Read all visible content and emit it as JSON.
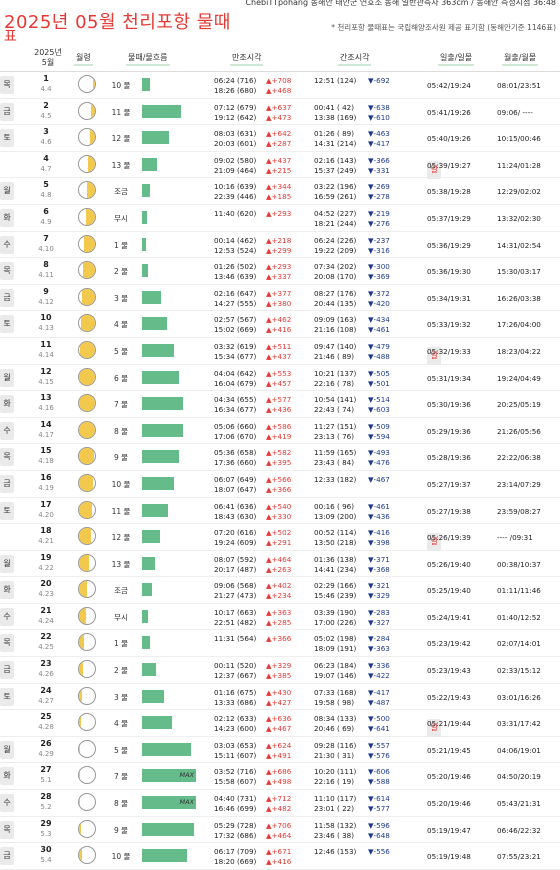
{
  "header": {
    "top_line": "ChebiTTpohang 동해안 태안군 연호소 동해 일반관측자 363cm / 동해안 측정시점 36:48",
    "title": "2025년 05월 천리포항 물때",
    "title_line2": "표",
    "note": "* 천리포항 물때표는 국립해양조사원 제공 표기함 (동해안기준 1146표)"
  },
  "columns": {
    "date_line1": "2025년",
    "date_line2": "5월",
    "moon": "월령",
    "tide": "물때/물흐름",
    "high": "만조시각",
    "low": "간조시각",
    "sun": "일출/일몰",
    "moonrs": "월출/월몰"
  },
  "rows": [
    {
      "dow": "목",
      "day": "1",
      "lunar": "4.4",
      "phase": 0.15,
      "tide": "10 물",
      "flow": 0.14,
      "max": "",
      "h1": "06:24 (716)",
      "hd1": "▲+708",
      "h2": "18:26 (680)",
      "hd2": "▲+468",
      "l1": "12:51 (124)",
      "ld1": "▼-692",
      "l2": "",
      "ld2": "",
      "sun": "05:42/19:24",
      "mrs": "08:01/23:51"
    },
    {
      "dow": "금",
      "day": "2",
      "lunar": "4.5",
      "phase": 0.25,
      "tide": "11 물",
      "flow": 0.72,
      "max": "",
      "h1": "07:12 (679)",
      "hd1": "▲+637",
      "h2": "19:12 (642)",
      "hd2": "▲+473",
      "l1": "00:41 ( 42)",
      "ld1": "▼-638",
      "l2": "13:38 (169)",
      "ld2": "▼-610",
      "sun": "05:41/19:26",
      "mrs": "09:06/ ----"
    },
    {
      "dow": "토",
      "day": "3",
      "lunar": "4.6",
      "phase": 0.33,
      "tide": "12 물",
      "flow": 0.5,
      "max": "",
      "h1": "08:03 (631)",
      "hd1": "▲+642",
      "h2": "20:03 (601)",
      "hd2": "▲+287",
      "l1": "01:26 ( 89)",
      "ld1": "▼-463",
      "l2": "14:31 (214)",
      "ld2": "▼-417",
      "sun": "05:40/19:26",
      "mrs": "10:15/00:46"
    },
    {
      "dow": "일",
      "day": "4",
      "lunar": "4.7",
      "phase": 0.42,
      "tide": "13 물",
      "flow": 0.27,
      "max": "",
      "h1": "09:02 (580)",
      "hd1": "▲+437",
      "h2": "21:09 (464)",
      "hd2": "▲+215",
      "l1": "02:16 (143)",
      "ld1": "▼-366",
      "l2": "15:37 (249)",
      "ld2": "▼-331",
      "sun": "05:39/19:27",
      "mrs": "11:24/01:28"
    },
    {
      "dow": "월",
      "day": "5",
      "lunar": "4.8",
      "phase": 0.5,
      "tide": "조금",
      "flow": 0.14,
      "max": "",
      "h1": "10:16 (639)",
      "hd1": "▲+344",
      "h2": "22:39 (446)",
      "hd2": "▲+185",
      "l1": "03:22 (196)",
      "ld1": "▼-269",
      "l2": "16:59 (261)",
      "ld2": "▼-278",
      "sun": "05:38/19:28",
      "mrs": "12:29/02:02"
    },
    {
      "dow": "화",
      "day": "6",
      "lunar": "4.9",
      "phase": 0.58,
      "tide": "무시",
      "flow": 0.1,
      "max": "",
      "h1": "11:40 (620)",
      "hd1": "▲+293",
      "h2": "",
      "hd2": "",
      "l1": "04:52 (227)",
      "ld1": "▼-219",
      "l2": "18:21 (244)",
      "ld2": "▼-276",
      "sun": "05:37/19:29",
      "mrs": "13:32/02:30"
    },
    {
      "dow": "수",
      "day": "7",
      "lunar": "4.10",
      "phase": 0.66,
      "tide": "1 물",
      "flow": 0.08,
      "max": "",
      "h1": "00:14 (462)",
      "hd1": "▲+218",
      "h2": "12:53 (524)",
      "hd2": "▲+299",
      "l1": "06:24 (226)",
      "ld1": "▼-237",
      "l2": "19:22 (209)",
      "ld2": "▼-316",
      "sun": "05:36/19:29",
      "mrs": "14:31/02:54"
    },
    {
      "dow": "목",
      "day": "8",
      "lunar": "4.11",
      "phase": 0.74,
      "tide": "2 물",
      "flow": 0.12,
      "max": "",
      "h1": "01:26 (502)",
      "hd1": "▲+293",
      "h2": "13:46 (639)",
      "hd2": "▲+337",
      "l1": "07:34 (202)",
      "ld1": "▼-300",
      "l2": "20:08 (170)",
      "ld2": "▼-369",
      "sun": "05:36/19:30",
      "mrs": "15:30/03:17"
    },
    {
      "dow": "금",
      "day": "9",
      "lunar": "4.12",
      "phase": 0.82,
      "tide": "3 물",
      "flow": 0.36,
      "max": "",
      "h1": "02:16 (647)",
      "hd1": "▲+377",
      "h2": "14:27 (555)",
      "hd2": "▲+380",
      "l1": "08:27 (176)",
      "ld1": "▼-372",
      "l2": "20:44 (135)",
      "ld2": "▼-420",
      "sun": "05:34/19:31",
      "mrs": "16:26/03:38"
    },
    {
      "dow": "토",
      "day": "10",
      "lunar": "4.13",
      "phase": 0.88,
      "tide": "4 물",
      "flow": 0.47,
      "max": "",
      "h1": "02:57 (567)",
      "hd1": "▲+462",
      "h2": "15:02 (669)",
      "hd2": "▲+416",
      "l1": "09:09 (163)",
      "ld1": "▼-434",
      "l2": "21:16 (108)",
      "ld2": "▼-461",
      "sun": "05:33/19:32",
      "mrs": "17:26/04:00"
    },
    {
      "dow": "일",
      "day": "11",
      "lunar": "4.14",
      "phase": 0.93,
      "tide": "5 물",
      "flow": 0.6,
      "max": "",
      "h1": "03:32 (619)",
      "hd1": "▲+511",
      "h2": "15:34 (677)",
      "hd2": "▲+437",
      "l1": "09:47 (140)",
      "ld1": "▼-479",
      "l2": "21:46 ( 89)",
      "ld2": "▼-488",
      "sun": "05:32/19:33",
      "mrs": "18:23/04:22"
    },
    {
      "dow": "월",
      "day": "12",
      "lunar": "4.15",
      "phase": 0.98,
      "tide": "6 물",
      "flow": 0.68,
      "max": "",
      "h1": "04:04 (642)",
      "hd1": "▲+553",
      "h2": "16:04 (679)",
      "hd2": "▲+457",
      "l1": "10:21 (137)",
      "ld1": "▼-505",
      "l2": "22:16 ( 78)",
      "ld2": "▼-501",
      "sun": "05:31/19:34",
      "mrs": "19:24/04:49"
    },
    {
      "dow": "화",
      "day": "13",
      "lunar": "4.16",
      "phase": 1.0,
      "tide": "7 물",
      "flow": 0.75,
      "max": "",
      "h1": "04:34 (655)",
      "hd1": "▲+577",
      "h2": "16:34 (677)",
      "hd2": "▲+436",
      "l1": "10:54 (141)",
      "ld1": "▼-514",
      "l2": "22:43 ( 74)",
      "ld2": "▼-603",
      "sun": "05:30/19:36",
      "mrs": "20:25/05:19"
    },
    {
      "dow": "수",
      "day": "14",
      "lunar": "4.17",
      "phase": 0.97,
      "tide": "8 물",
      "flow": 0.75,
      "max": "",
      "h1": "05:06 (660)",
      "hd1": "▲+586",
      "h2": "17:06 (670)",
      "hd2": "▲+419",
      "l1": "11:27 (151)",
      "ld1": "▼-509",
      "l2": "23:13 ( 76)",
      "ld2": "▼-594",
      "sun": "05:29/19:36",
      "mrs": "21:26/05:56"
    },
    {
      "dow": "목",
      "day": "15",
      "lunar": "4.18",
      "phase": 0.93,
      "tide": "9 물",
      "flow": 0.68,
      "max": "",
      "h1": "05:36 (658)",
      "hd1": "▲+582",
      "h2": "17:36 (660)",
      "hd2": "▲+395",
      "l1": "11:59 (165)",
      "ld1": "▼-493",
      "l2": "23:43 ( 84)",
      "ld2": "▼-476",
      "sun": "05:28/19:36",
      "mrs": "22:22/06:38"
    },
    {
      "dow": "금",
      "day": "16",
      "lunar": "4.19",
      "phase": 0.88,
      "tide": "10 물",
      "flow": 0.6,
      "max": "",
      "h1": "06:07 (649)",
      "hd1": "▲+566",
      "h2": "18:07 (647)",
      "hd2": "▲+366",
      "l1": "12:33 (182)",
      "ld1": "▼-467",
      "l2": "",
      "ld2": "",
      "sun": "05:27/19:37",
      "mrs": "23:14/07:29"
    },
    {
      "dow": "토",
      "day": "17",
      "lunar": "4.20",
      "phase": 0.8,
      "tide": "11 물",
      "flow": 0.48,
      "max": "",
      "h1": "06:41 (636)",
      "hd1": "▲+540",
      "h2": "18:43 (630)",
      "hd2": "▲+330",
      "l1": "00:16 ( 96)",
      "ld1": "▼-461",
      "l2": "13:09 (200)",
      "ld2": "▼-436",
      "sun": "05:27/19:38",
      "mrs": "23:59/08:27"
    },
    {
      "dow": "일",
      "day": "18",
      "lunar": "4.21",
      "phase": 0.72,
      "tide": "12 물",
      "flow": 0.34,
      "max": "",
      "h1": "07:20 (616)",
      "hd1": "▲+502",
      "h2": "19:24 (609)",
      "hd2": "▲+291",
      "l1": "00:52 (114)",
      "ld1": "▼-416",
      "l2": "13:50 (218)",
      "ld2": "▼-398",
      "sun": "05:26/19:39",
      "mrs": "---- /09:31"
    },
    {
      "dow": "월",
      "day": "19",
      "lunar": "4.22",
      "phase": 0.62,
      "tide": "13 물",
      "flow": 0.24,
      "max": "",
      "h1": "08:07 (592)",
      "hd1": "▲+464",
      "h2": "20:17 (487)",
      "hd2": "▲+263",
      "l1": "01:36 (138)",
      "ld1": "▼-371",
      "l2": "14:41 (234)",
      "ld2": "▼-368",
      "sun": "05:26/19:40",
      "mrs": "00:38/10:37"
    },
    {
      "dow": "화",
      "day": "20",
      "lunar": "4.23",
      "phase": 0.52,
      "tide": "조금",
      "flow": 0.18,
      "max": "",
      "h1": "09:06 (568)",
      "hd1": "▲+402",
      "h2": "21:27 (473)",
      "hd2": "▲+234",
      "l1": "02:29 (166)",
      "ld1": "▼-321",
      "l2": "15:46 (239)",
      "ld2": "▼-329",
      "sun": "05:25/19:40",
      "mrs": "01:11/11:46"
    },
    {
      "dow": "수",
      "day": "21",
      "lunar": "4.24",
      "phase": 0.42,
      "tide": "무시",
      "flow": 0.12,
      "max": "",
      "h1": "10:17 (663)",
      "hd1": "▲+363",
      "h2": "22:51 (482)",
      "hd2": "▲+285",
      "l1": "03:39 (190)",
      "ld1": "▼-283",
      "l2": "17:00 (226)",
      "ld2": "▼-327",
      "sun": "05:24/19:41",
      "mrs": "01:40/12:52"
    },
    {
      "dow": "목",
      "day": "22",
      "lunar": "4.25",
      "phase": 0.32,
      "tide": "1 물",
      "flow": 0.14,
      "max": "",
      "h1": "11:31 (564)",
      "hd1": "▲+366",
      "h2": "",
      "hd2": "",
      "l1": "05:02 (198)",
      "ld1": "▼-284",
      "l2": "18:09 (191)",
      "ld2": "▼-363",
      "sun": "05:23/19:42",
      "mrs": "02:07/14:01"
    },
    {
      "dow": "금",
      "day": "23",
      "lunar": "4.26",
      "phase": 0.24,
      "tide": "2 물",
      "flow": 0.26,
      "max": "",
      "h1": "00:11 (520)",
      "hd1": "▲+329",
      "h2": "12:37 (667)",
      "hd2": "▲+385",
      "l1": "06:23 (184)",
      "ld1": "▼-336",
      "l2": "19:07 (146)",
      "ld2": "▼-422",
      "sun": "05:23/19:43",
      "mrs": "02:33/15:12"
    },
    {
      "dow": "토",
      "day": "24",
      "lunar": "4.27",
      "phase": 0.16,
      "tide": "3 물",
      "flow": 0.4,
      "max": "",
      "h1": "01:16 (675)",
      "hd1": "▲+430",
      "h2": "13:33 (686)",
      "hd2": "▲+427",
      "l1": "07:33 (168)",
      "ld1": "▼-417",
      "l2": "19:58 ( 98)",
      "ld2": "▼-487",
      "sun": "05:22/19:43",
      "mrs": "03:01/16:26"
    },
    {
      "dow": "일",
      "day": "25",
      "lunar": "4.28",
      "phase": 0.1,
      "tide": "4 물",
      "flow": 0.55,
      "max": "",
      "h1": "02:12 (633)",
      "hd1": "▲+636",
      "h2": "14:23 (600)",
      "hd2": "▲+467",
      "l1": "08:34 (133)",
      "ld1": "▼-500",
      "l2": "20:46 ( 69)",
      "ld2": "▼-641",
      "sun": "05:21/19:44",
      "mrs": "03:31/17:42"
    },
    {
      "dow": "월",
      "day": "26",
      "lunar": "4.29",
      "phase": 0.05,
      "tide": "5 물",
      "flow": 0.9,
      "max": "",
      "h1": "03:03 (653)",
      "hd1": "▲+624",
      "h2": "15:11 (607)",
      "hd2": "▲+491",
      "l1": "09:28 (116)",
      "ld1": "▼-557",
      "l2": "21:30 ( 31)",
      "ld2": "▼-576",
      "sun": "05:21/19:45",
      "mrs": "04:06/19:01"
    },
    {
      "dow": "화",
      "day": "27",
      "lunar": "5.1",
      "phase": 0.02,
      "tide": "7 물",
      "flow": 1.0,
      "max": "MAX",
      "h1": "03:52 (716)",
      "hd1": "▲+686",
      "h2": "15:58 (607)",
      "hd2": "▲+498",
      "l1": "10:20 (111)",
      "ld1": "▼-606",
      "l2": "22:16 ( 19)",
      "ld2": "▼-588",
      "sun": "05:20/19:46",
      "mrs": "04:50/20:19"
    },
    {
      "dow": "수",
      "day": "28",
      "lunar": "5.2",
      "phase": 0.08,
      "tide": "8 물",
      "flow": 1.0,
      "max": "MAX",
      "h1": "04:40 (731)",
      "hd1": "▲+712",
      "h2": "16:46 (699)",
      "hd2": "▲+482",
      "l1": "11:10 (117)",
      "ld1": "▼-614",
      "l2": "23:01 ( 22)",
      "ld2": "▼-577",
      "sun": "05:20/19:46",
      "mrs": "05:43/21:31"
    },
    {
      "dow": "목",
      "day": "29",
      "lunar": "5.3",
      "phase": 0.14,
      "tide": "9 물",
      "flow": 0.96,
      "max": "",
      "h1": "05:29 (728)",
      "hd1": "▲+706",
      "h2": "17:32 (686)",
      "hd2": "▲+464",
      "l1": "11:58 (132)",
      "ld1": "▼-596",
      "l2": "23:46 ( 38)",
      "ld2": "▼-648",
      "sun": "05:19/19:47",
      "mrs": "06:46/22:32"
    },
    {
      "dow": "금",
      "day": "30",
      "lunar": "5.4",
      "phase": 0.2,
      "tide": "10 물",
      "flow": 0.84,
      "max": "",
      "h1": "06:17 (709)",
      "hd1": "▲+671",
      "h2": "18:20 (669)",
      "hd2": "▲+416",
      "l1": "12:46 (153)",
      "ld1": "▼-556",
      "l2": "",
      "ld2": "",
      "sun": "05:19/19:48",
      "mrs": "07:55/23:21"
    },
    {
      "dow": "토",
      "day": "31",
      "lunar": "5.5",
      "phase": 0.28,
      "tide": "11 물",
      "flow": 0.7,
      "max": "",
      "h1": "07:04 (679)",
      "hd1": "▲+613",
      "h2": "19:07 (649)",
      "hd2": "▲+373",
      "l1": "00:31 ( 66)",
      "ld1": "▼-603",
      "l2": "13:33 (176)",
      "ld2": "▼-603",
      "sun": "05:19/19:48",
      "mrs": "09:07/24:00"
    }
  ]
}
